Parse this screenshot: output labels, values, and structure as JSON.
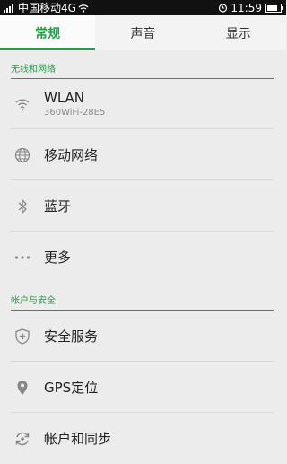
{
  "status_bar": {
    "carrier": "中国移动4G",
    "time": "11:59",
    "battery_level": 0.75
  },
  "tabs": [
    {
      "label": "常规",
      "active": true
    },
    {
      "label": "声音",
      "active": false
    },
    {
      "label": "显示",
      "active": false
    }
  ],
  "sections": [
    {
      "header": "无线和网络",
      "items": [
        {
          "label": "WLAN",
          "sub": "360WiFi-28E5",
          "icon": "wifi-icon"
        },
        {
          "label": "移动网络",
          "icon": "globe-icon"
        },
        {
          "label": "蓝牙",
          "icon": "bluetooth-icon"
        },
        {
          "label": "更多",
          "icon": "more-dots-icon"
        }
      ]
    },
    {
      "header": "帐户与安全",
      "items": [
        {
          "label": "安全服务",
          "icon": "shield-icon"
        },
        {
          "label": "GPS定位",
          "icon": "location-pin-icon"
        },
        {
          "label": "帐户和同步",
          "icon": "sync-icon"
        }
      ]
    }
  ],
  "colors": {
    "accent": "#2a9a4a",
    "background": "#ececec",
    "status_bar": "#111111"
  }
}
